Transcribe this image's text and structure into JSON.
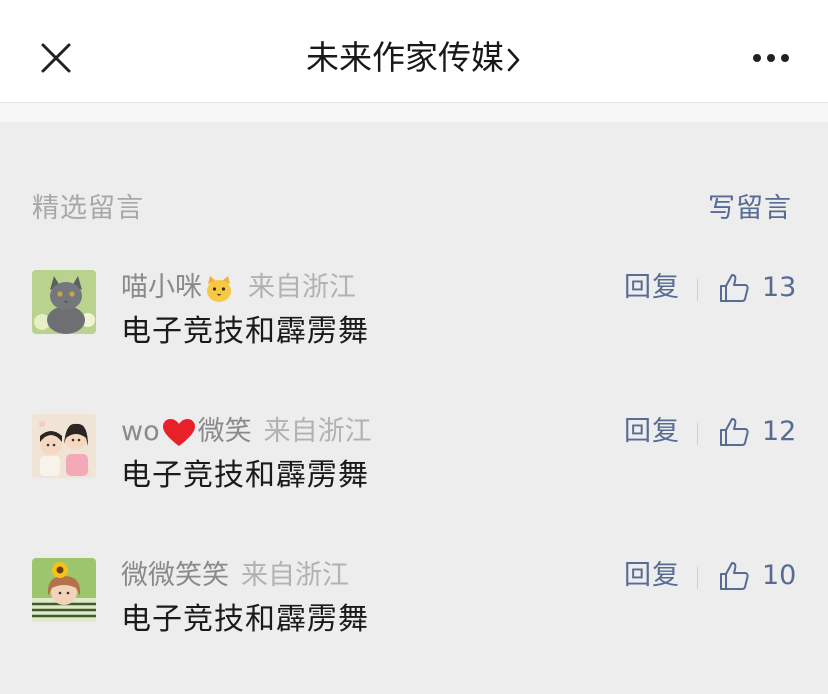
{
  "nav": {
    "title": "未来作家传媒",
    "close_icon": "close-icon",
    "chevron_icon": "chevron-right-icon",
    "more_icon": "more-dots-icon"
  },
  "section": {
    "label": "精选留言",
    "write_label": "写留言"
  },
  "comments": [
    {
      "nick": "喵小咪",
      "emoji": "cat-face-emoji",
      "location": "来自浙江",
      "content": "电子竞技和霹雳舞",
      "reply_label": "回复",
      "likes": "13",
      "avatar": "gray-cat-avatar"
    },
    {
      "nick_prefix": "wo",
      "emoji": "red-heart-emoji",
      "nick_suffix": "微笑",
      "location": "来自浙江",
      "content": "电子竞技和霹雳舞",
      "reply_label": "回复",
      "likes": "12",
      "avatar": "cartoon-couple-avatar"
    },
    {
      "nick": "微微笑笑",
      "location": "来自浙江",
      "content": "电子竞技和霹雳舞",
      "reply_label": "回复",
      "likes": "10",
      "avatar": "girl-sunflower-avatar"
    }
  ],
  "colors": {
    "link": "#576b95",
    "nick": "#8a8a8a",
    "location": "#b2b2b2",
    "background": "#ededed"
  }
}
